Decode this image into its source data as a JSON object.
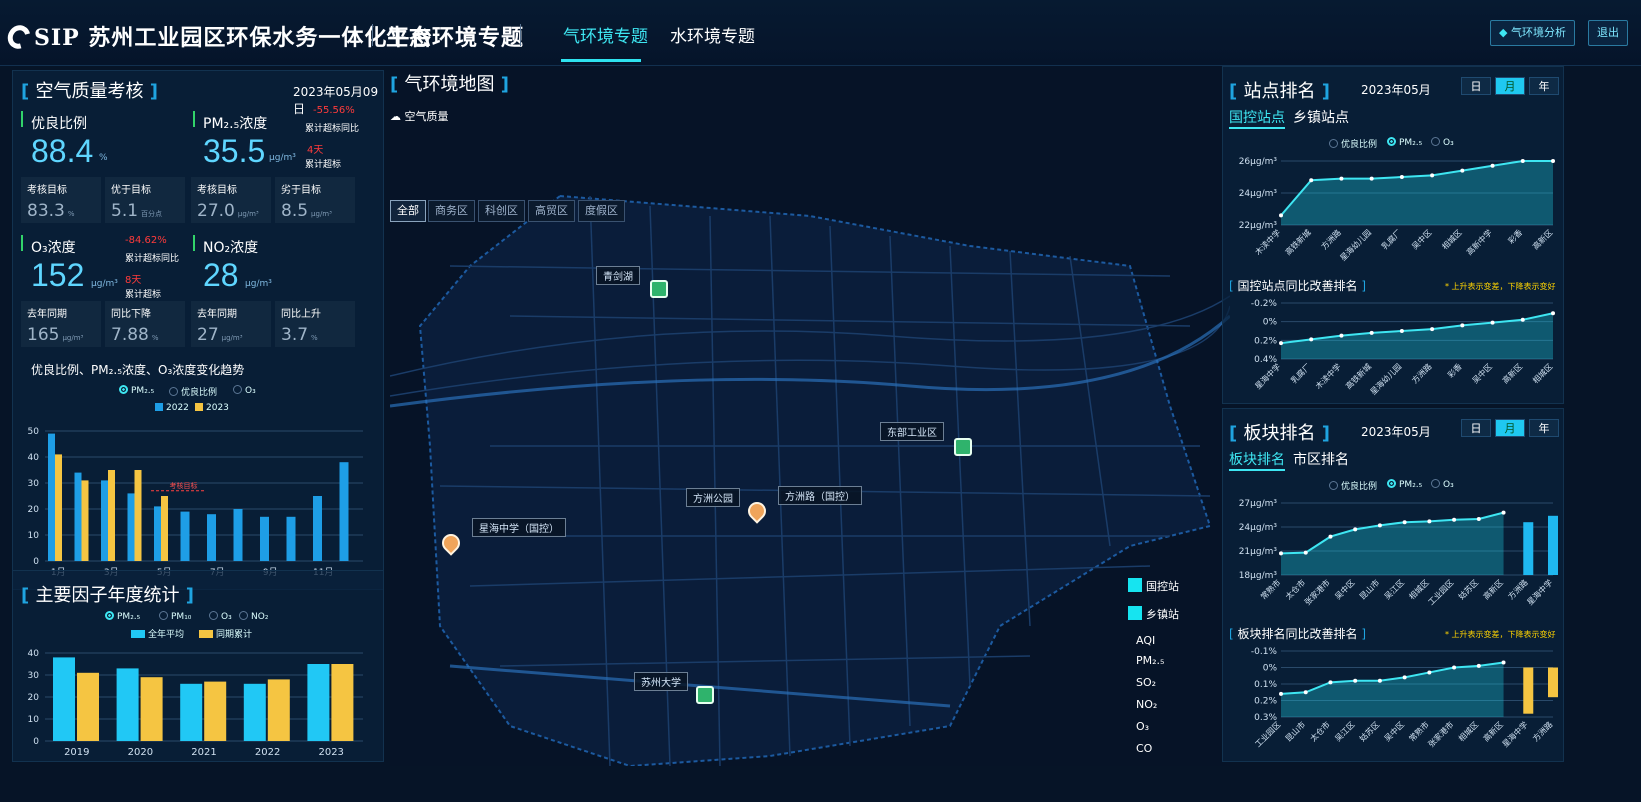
{
  "header": {
    "logo_text": "SIP 苏州工业园区环保水务一体化平台",
    "subtitle": "生态环境专题",
    "tabs": [
      "气环境专题",
      "水环境专题"
    ],
    "btn_analysis": "气环境分析",
    "btn_exit": "退出"
  },
  "aq": {
    "title": "空气质量考核",
    "date": "2023年05月09日",
    "good_ratio": {
      "label": "优良比例",
      "value": "88.4",
      "unit": "%"
    },
    "pm25": {
      "label": "PM₂.₅浓度",
      "value": "35.5",
      "unit": "μg/m³",
      "red_pct": "-55.56%",
      "red_label": "累计超标同比",
      "days": "4天",
      "days_label": "累计超标"
    },
    "row1": [
      {
        "t": "考核目标",
        "v": "83.3",
        "u": "%"
      },
      {
        "t": "优于目标",
        "v": "5.1",
        "u": "百分点"
      },
      {
        "t": "考核目标",
        "v": "27.0",
        "u": "μg/m³"
      },
      {
        "t": "劣于目标",
        "v": "8.5",
        "u": "μg/m³"
      }
    ],
    "o3": {
      "label": "O₃浓度",
      "value": "152",
      "unit": "μg/m³",
      "red_pct": "-84.62%",
      "red_label": "累计超标同比",
      "days": "8天",
      "days_label": "累计超标"
    },
    "no2": {
      "label": "NO₂浓度",
      "value": "28",
      "unit": "μg/m³"
    },
    "row2": [
      {
        "t": "去年同期",
        "v": "165",
        "u": "μg/m³"
      },
      {
        "t": "同比下降",
        "v": "7.88",
        "u": "%"
      },
      {
        "t": "去年同期",
        "v": "27",
        "u": "μg/m³"
      },
      {
        "t": "同比上升",
        "v": "3.7",
        "u": "%"
      }
    ],
    "trend_title": "优良比例、PM₂.₅浓度、O₃浓度变化趋势",
    "trend_radios": [
      "PM₂.₅",
      "优良比例",
      "O₃"
    ],
    "trend_legend": [
      "2022",
      "2023"
    ]
  },
  "annual": {
    "title": "主要因子年度统计",
    "radios": [
      "PM₂.₅",
      "PM₁₀",
      "O₃",
      "NO₂"
    ],
    "legend": [
      "全年平均",
      "同期累计"
    ]
  },
  "map": {
    "title": "气环境地图",
    "aq_label": "空气质量",
    "filters": [
      "全部",
      "商务区",
      "科创区",
      "高贸区",
      "度假区"
    ],
    "labels": [
      "青剑湖",
      "东部工业区",
      "方洲公园",
      "方洲路（国控）",
      "星海中学（国控）",
      "苏州大学"
    ],
    "legend": [
      "国控站",
      "乡镇站"
    ],
    "pollutants": [
      "AQI",
      "PM₂.₅",
      "SO₂",
      "NO₂",
      "O₃",
      "CO"
    ]
  },
  "station": {
    "title": "站点排名",
    "date": "2023年05月",
    "toggles": [
      "日",
      "月",
      "年"
    ],
    "subtabs": [
      "国控站点",
      "乡镇站点"
    ],
    "radios": [
      "优良比例",
      "PM₂.₅",
      "O₃"
    ],
    "improve_title": "国控站点同比改善排名",
    "note": "* 上升表示变差，下降表示变好"
  },
  "block": {
    "title": "板块排名",
    "date": "2023年05月",
    "toggles": [
      "日",
      "月",
      "年"
    ],
    "subtabs": [
      "板块排名",
      "市区排名"
    ],
    "radios": [
      "优良比例",
      "PM₂.₅",
      "O₃"
    ],
    "improve_title": "板块排名同比改善排名",
    "note": "* 上升表示变差，下降表示变好"
  },
  "chart_data": [
    {
      "type": "bar",
      "id": "trend",
      "categories": [
        "1月",
        "2月",
        "3月",
        "4月",
        "5月",
        "6月",
        "7月",
        "8月",
        "9月",
        "10月",
        "11月",
        "12月"
      ],
      "x_tick_labels": [
        "1月",
        "3月",
        "5月",
        "7月",
        "9月",
        "11月"
      ],
      "series": [
        {
          "name": "2022",
          "values": [
            49,
            34,
            31,
            26,
            21,
            19,
            18,
            20,
            17,
            17,
            25,
            38
          ]
        },
        {
          "name": "2023",
          "values": [
            41,
            31,
            35,
            35,
            25
          ]
        }
      ],
      "ylim": [
        0,
        50
      ],
      "yticks": [
        0,
        10,
        20,
        30,
        40,
        50
      ],
      "annotation": "考核目标",
      "target": 27,
      "colors": {
        "2022": "#1e9ee6",
        "2023": "#f5c542"
      }
    },
    {
      "type": "bar",
      "id": "annual",
      "categories": [
        "2019",
        "2020",
        "2021",
        "2022",
        "2023"
      ],
      "series": [
        {
          "name": "全年平均",
          "values": [
            38,
            33,
            26,
            26,
            35
          ]
        },
        {
          "name": "同期累计",
          "values": [
            31,
            29,
            27,
            28,
            35
          ]
        }
      ],
      "ylim": [
        0,
        40
      ],
      "yticks": [
        0,
        10,
        20,
        30,
        40
      ],
      "colors": {
        "全年平均": "#21c8f5",
        "同期累计": "#f5c542"
      }
    },
    {
      "type": "area",
      "id": "station_rank",
      "categories": [
        "木渎中学",
        "高铁新城",
        "方洲路",
        "星海幼儿园",
        "乳腐厂",
        "吴中区",
        "相城区",
        "高新中学",
        "彩香",
        "高新区"
      ],
      "values": [
        22.6,
        24.8,
        24.9,
        24.9,
        25.0,
        25.1,
        25.4,
        25.7,
        26.0,
        26.0
      ],
      "ylim": [
        22,
        26
      ],
      "yticks": [
        "22μg/m³",
        "24μg/m³",
        "26μg/m³"
      ]
    },
    {
      "type": "area",
      "id": "station_improve",
      "categories": [
        "星海中学",
        "乳腐厂",
        "木渎中学",
        "高铁新城",
        "星海幼儿园",
        "方洲路",
        "彩香",
        "吴中区",
        "高新区",
        "相城区"
      ],
      "values": [
        0.23,
        0.19,
        0.15,
        0.12,
        0.1,
        0.08,
        0.04,
        0.01,
        -0.02,
        -0.09
      ],
      "ylim": [
        -0.2,
        0.4
      ],
      "yticks": [
        "-0.2%",
        "0%",
        "0.2%",
        "0.4%"
      ]
    },
    {
      "type": "area",
      "id": "block_rank",
      "categories": [
        "常熟市",
        "太仓市",
        "张家港市",
        "吴中区",
        "昆山市",
        "吴江区",
        "相城区",
        "工业园区",
        "姑苏区",
        "高新区",
        "方洲路",
        "星海中学"
      ],
      "values": [
        20.7,
        20.8,
        22.8,
        23.7,
        24.2,
        24.6,
        24.7,
        24.9,
        25.0,
        25.8,
        24.6,
        25.4
      ],
      "ylim": [
        18,
        27
      ],
      "yticks": [
        "18μg/m³",
        "21μg/m³",
        "24μg/m³",
        "27μg/m³"
      ]
    },
    {
      "type": "area",
      "id": "block_improve",
      "categories": [
        "工业园区",
        "昆山市",
        "太仓市",
        "吴江区",
        "姑苏区",
        "吴中区",
        "常熟市",
        "张家港市",
        "相城区",
        "高新区",
        "星海中学",
        "方洲路"
      ],
      "values": [
        0.16,
        0.15,
        0.09,
        0.08,
        0.08,
        0.06,
        0.03,
        0.0,
        -0.01,
        -0.03,
        0.28,
        0.18
      ],
      "ylim": [
        -0.1,
        0.3
      ],
      "yticks": [
        "-0.1%",
        "0%",
        "0.1%",
        "0.2%",
        "0.3%"
      ]
    }
  ]
}
